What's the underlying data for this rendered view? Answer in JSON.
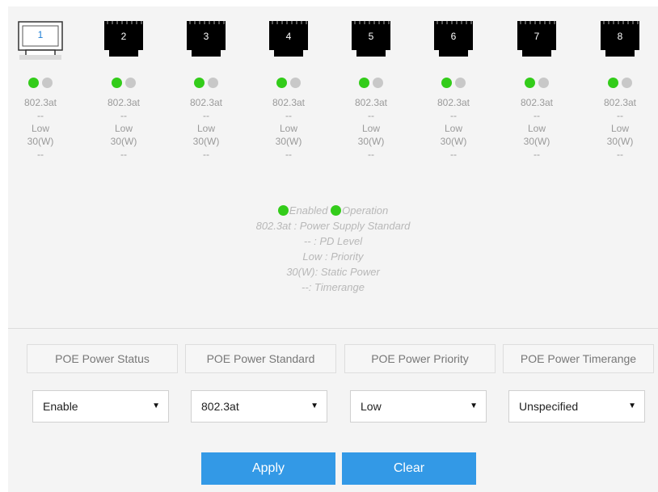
{
  "ports": [
    {
      "number": "1",
      "selected": true,
      "standard": "802.3at",
      "pd_level": "--",
      "priority": "Low",
      "power": "30(W)",
      "timerange": "--"
    },
    {
      "number": "2",
      "selected": false,
      "standard": "802.3at",
      "pd_level": "--",
      "priority": "Low",
      "power": "30(W)",
      "timerange": "--"
    },
    {
      "number": "3",
      "selected": false,
      "standard": "802.3at",
      "pd_level": "--",
      "priority": "Low",
      "power": "30(W)",
      "timerange": "--"
    },
    {
      "number": "4",
      "selected": false,
      "standard": "802.3at",
      "pd_level": "--",
      "priority": "Low",
      "power": "30(W)",
      "timerange": "--"
    },
    {
      "number": "5",
      "selected": false,
      "standard": "802.3at",
      "pd_level": "--",
      "priority": "Low",
      "power": "30(W)",
      "timerange": "--"
    },
    {
      "number": "6",
      "selected": false,
      "standard": "802.3at",
      "pd_level": "--",
      "priority": "Low",
      "power": "30(W)",
      "timerange": "--"
    },
    {
      "number": "7",
      "selected": false,
      "standard": "802.3at",
      "pd_level": "--",
      "priority": "Low",
      "power": "30(W)",
      "timerange": "--"
    },
    {
      "number": "8",
      "selected": false,
      "standard": "802.3at",
      "pd_level": "--",
      "priority": "Low",
      "power": "30(W)",
      "timerange": "--"
    }
  ],
  "legend": {
    "enabled": "Enabled",
    "operation": "Operation",
    "standard": "802.3at : Power Supply Standard",
    "pd_level": "-- : PD Level",
    "priority": "Low : Priority",
    "power": "30(W): Static Power",
    "timerange": "--: Timerange"
  },
  "form": {
    "headers": {
      "status": "POE Power Status",
      "standard": "POE Power Standard",
      "priority": "POE Power Priority",
      "timerange": "POE Power Timerange"
    },
    "values": {
      "status": "Enable",
      "standard": "802.3at",
      "priority": "Low",
      "timerange": "Unspecified"
    },
    "dropdown_arrow": "▼"
  },
  "buttons": {
    "apply": "Apply",
    "clear": "Clear"
  },
  "colors": {
    "led_enabled": "#33cc1a",
    "led_off": "#c8c8c8",
    "button": "#3399e6",
    "jack": "#000000",
    "selected_number": "#1e7fd6"
  }
}
